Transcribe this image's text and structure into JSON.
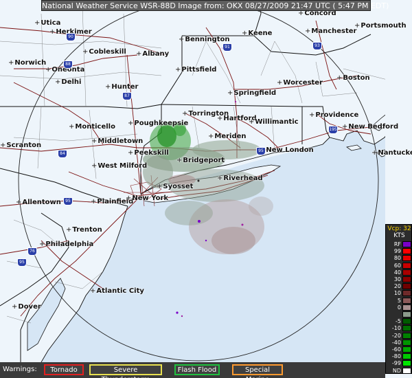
{
  "header": {
    "title": "National Weather Service WSR-88D Image from: OKX 08/27/2009 21:47 UTC ( 5:47 PM EDT)"
  },
  "cities": [
    {
      "name": "Utica"
    },
    {
      "name": "Herkimer"
    },
    {
      "name": "Concord"
    },
    {
      "name": "Portsmouth"
    },
    {
      "name": "Manchester"
    },
    {
      "name": "Keene"
    },
    {
      "name": "Bennington"
    },
    {
      "name": "Cobleskill"
    },
    {
      "name": "Albany"
    },
    {
      "name": "Norwich"
    },
    {
      "name": "Oneonta"
    },
    {
      "name": "Delhi"
    },
    {
      "name": "Pittsfield"
    },
    {
      "name": "Worcester"
    },
    {
      "name": "Boston"
    },
    {
      "name": "Hunter"
    },
    {
      "name": "Springfield"
    },
    {
      "name": "Torrington"
    },
    {
      "name": "Hartford"
    },
    {
      "name": "Willimantic"
    },
    {
      "name": "Providence"
    },
    {
      "name": "New Bedford"
    },
    {
      "name": "Poughkeepsie"
    },
    {
      "name": "Monticello"
    },
    {
      "name": "Scranton"
    },
    {
      "name": "Middletown"
    },
    {
      "name": "Meriden"
    },
    {
      "name": "Peekskill"
    },
    {
      "name": "New London"
    },
    {
      "name": "Nantucket"
    },
    {
      "name": "West Milford"
    },
    {
      "name": "Bridgeport"
    },
    {
      "name": "Syosset"
    },
    {
      "name": "Riverhead"
    },
    {
      "name": "Allentown"
    },
    {
      "name": "Plainfield"
    },
    {
      "name": "New York"
    },
    {
      "name": "Trenton"
    },
    {
      "name": "Philadelphia"
    },
    {
      "name": "Atlantic City"
    },
    {
      "name": "Dover"
    }
  ],
  "highways": [
    {
      "label": "90"
    },
    {
      "label": "88"
    },
    {
      "label": "91"
    },
    {
      "label": "93"
    },
    {
      "label": "87"
    },
    {
      "label": "84"
    },
    {
      "label": "95"
    },
    {
      "label": "95"
    },
    {
      "label": "195"
    },
    {
      "label": "76"
    },
    {
      "label": "95"
    }
  ],
  "legend": {
    "title": "Vcp: 32",
    "unit": "KTS",
    "items": [
      {
        "label": "RF",
        "color": "#7a00c8"
      },
      {
        "label": "99",
        "color": "#ff0000"
      },
      {
        "label": "80",
        "color": "#e60000"
      },
      {
        "label": "60",
        "color": "#c80000"
      },
      {
        "label": "40",
        "color": "#aa0000"
      },
      {
        "label": "30",
        "color": "#8c0000"
      },
      {
        "label": "20",
        "color": "#700000"
      },
      {
        "label": "10",
        "color": "#6e2a2a"
      },
      {
        "label": "5",
        "color": "#8c5a5a"
      },
      {
        "label": "0",
        "color": "#a89090"
      },
      {
        "label": "",
        "color": "#8c9c8c"
      },
      {
        "label": "-5",
        "color": "#005a00"
      },
      {
        "label": "-10",
        "color": "#006e00"
      },
      {
        "label": "-20",
        "color": "#008000"
      },
      {
        "label": "-40",
        "color": "#009600"
      },
      {
        "label": "-60",
        "color": "#00aa00"
      },
      {
        "label": "-80",
        "color": "#00c800"
      },
      {
        "label": "-99",
        "color": "#00e600"
      },
      {
        "label": "ND",
        "color": "#ffffff"
      }
    ]
  },
  "warnings": {
    "label": "Warnings:",
    "items": [
      {
        "label": "Tornado",
        "color": "#e02020"
      },
      {
        "label": "Severe Thunderstorm",
        "color": "#e8e050"
      },
      {
        "label": "Flash Flood",
        "color": "#20c040"
      },
      {
        "label": "Special Marine",
        "color": "#ff9a30"
      }
    ]
  }
}
